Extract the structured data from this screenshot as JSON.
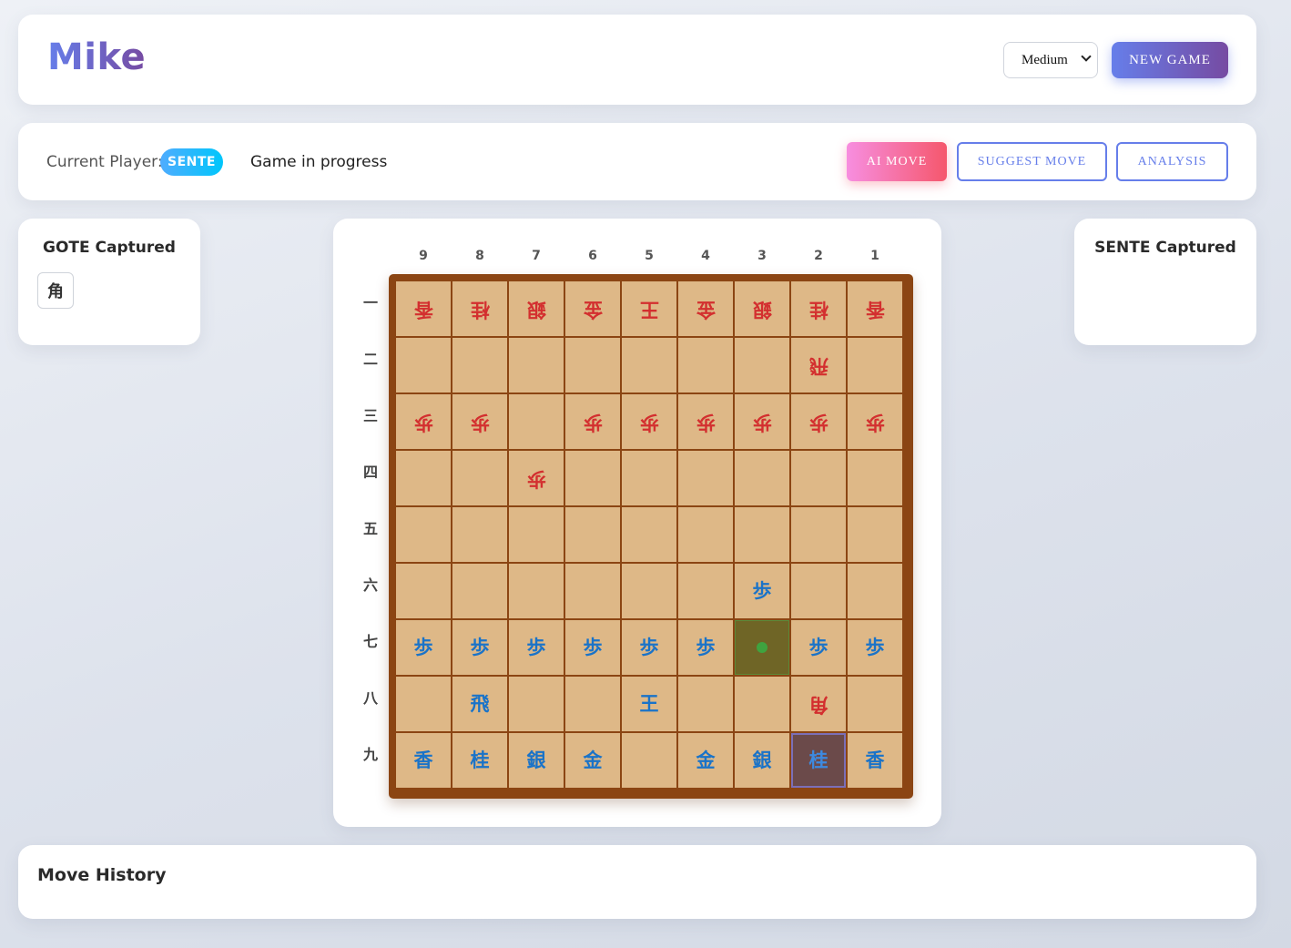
{
  "header": {
    "title": "Mike",
    "difficulty": {
      "selected": "Medium"
    },
    "new_game_label": "NEW GAME"
  },
  "status": {
    "current_player_label": "Current Player:",
    "current_player": "SENTE",
    "game_status": "Game in progress",
    "ai_move_label": "AI MOVE",
    "suggest_move_label": "SUGGEST MOVE",
    "analysis_label": "ANALYSIS"
  },
  "gote_captured": {
    "title": "GOTE Captured",
    "pieces": [
      "角"
    ]
  },
  "sente_captured": {
    "title": "SENTE Captured",
    "pieces": []
  },
  "board": {
    "files": [
      "9",
      "8",
      "7",
      "6",
      "5",
      "4",
      "3",
      "2",
      "1"
    ],
    "ranks": [
      "一",
      "二",
      "三",
      "四",
      "五",
      "六",
      "七",
      "八",
      "九"
    ],
    "rows": [
      [
        {
          "k": "香",
          "o": "gote"
        },
        {
          "k": "桂",
          "o": "gote"
        },
        {
          "k": "銀",
          "o": "gote"
        },
        {
          "k": "金",
          "o": "gote"
        },
        {
          "k": "王",
          "o": "gote"
        },
        {
          "k": "金",
          "o": "gote"
        },
        {
          "k": "銀",
          "o": "gote"
        },
        {
          "k": "桂",
          "o": "gote"
        },
        {
          "k": "香",
          "o": "gote"
        }
      ],
      [
        null,
        null,
        null,
        null,
        null,
        null,
        null,
        {
          "k": "飛",
          "o": "gote"
        },
        null
      ],
      [
        {
          "k": "歩",
          "o": "gote"
        },
        {
          "k": "歩",
          "o": "gote"
        },
        null,
        {
          "k": "歩",
          "o": "gote"
        },
        {
          "k": "歩",
          "o": "gote"
        },
        {
          "k": "歩",
          "o": "gote"
        },
        {
          "k": "歩",
          "o": "gote"
        },
        {
          "k": "歩",
          "o": "gote"
        },
        {
          "k": "歩",
          "o": "gote"
        }
      ],
      [
        null,
        null,
        {
          "k": "歩",
          "o": "gote"
        },
        null,
        null,
        null,
        null,
        null,
        null
      ],
      [
        null,
        null,
        null,
        null,
        null,
        null,
        null,
        null,
        null
      ],
      [
        null,
        null,
        null,
        null,
        null,
        null,
        {
          "k": "歩",
          "o": "sente"
        },
        null,
        null
      ],
      [
        {
          "k": "歩",
          "o": "sente"
        },
        {
          "k": "歩",
          "o": "sente"
        },
        {
          "k": "歩",
          "o": "sente"
        },
        {
          "k": "歩",
          "o": "sente"
        },
        {
          "k": "歩",
          "o": "sente"
        },
        {
          "k": "歩",
          "o": "sente"
        },
        null,
        {
          "k": "歩",
          "o": "sente"
        },
        {
          "k": "歩",
          "o": "sente"
        }
      ],
      [
        null,
        {
          "k": "飛",
          "o": "sente"
        },
        null,
        null,
        {
          "k": "王",
          "o": "sente"
        },
        null,
        null,
        {
          "k": "角",
          "o": "gote"
        },
        null
      ],
      [
        {
          "k": "香",
          "o": "sente"
        },
        {
          "k": "桂",
          "o": "sente"
        },
        {
          "k": "銀",
          "o": "sente"
        },
        {
          "k": "金",
          "o": "sente"
        },
        null,
        {
          "k": "金",
          "o": "sente"
        },
        {
          "k": "銀",
          "o": "sente"
        },
        {
          "k": "桂",
          "o": "sente"
        },
        {
          "k": "香",
          "o": "sente"
        }
      ]
    ],
    "selected_square": {
      "file": "3",
      "rank": "七"
    },
    "last_move_square": {
      "file": "2",
      "rank": "九"
    },
    "colors": {
      "sente": "#1a73c8",
      "gote": "#d32f2f",
      "square": "#deb887",
      "frame": "#8b4513"
    }
  },
  "move_history": {
    "title": "Move History",
    "moves": []
  }
}
